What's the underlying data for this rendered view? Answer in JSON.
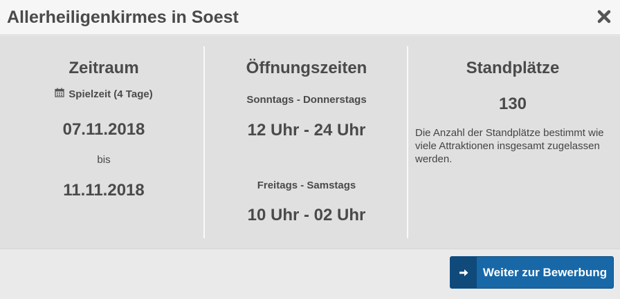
{
  "header": {
    "title": "Allerheiligenkirmes in Soest",
    "close_icon": "close-icon"
  },
  "zeitraum": {
    "heading": "Zeitraum",
    "spielzeit": "Spielzeit (4 Tage)",
    "calendar_icon": "calendar-icon",
    "start": "07.11.2018",
    "separator": "bis",
    "end": "11.11.2018"
  },
  "oeffnungszeiten": {
    "heading": "Öffnungszeiten",
    "groups": [
      {
        "days": "Sonntags - Donnerstags",
        "hours": "12 Uhr - 24 Uhr"
      },
      {
        "days": "Freitags - Samstags",
        "hours": "10 Uhr - 02 Uhr"
      }
    ]
  },
  "standplaetze": {
    "heading": "Standplätze",
    "count": "130",
    "description": "Die Anzahl der Standplätze bestimmt wie viele Attraktionen insgesamt zugelassen werden."
  },
  "footer": {
    "button_label": "Weiter zur Bewerbung",
    "button_icon": "arrow-right-icon"
  },
  "colors": {
    "button": "#1868a8",
    "button_icon_bg": "#0f4a7a",
    "panel": "#e0e0e0"
  }
}
